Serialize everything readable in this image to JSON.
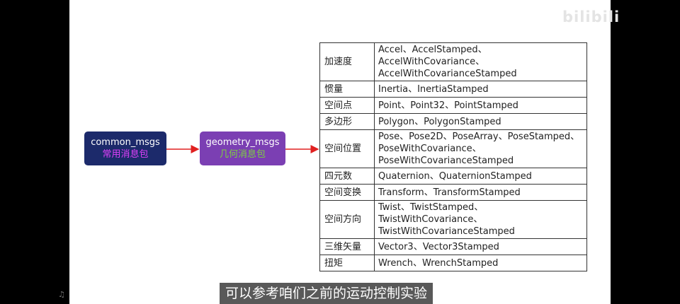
{
  "watermark": "bilibili",
  "nodes": {
    "common": {
      "title": "common_msgs",
      "subtitle": "常用消息包"
    },
    "geometry": {
      "title": "geometry_msgs",
      "subtitle": "几何消息包"
    }
  },
  "rows": [
    {
      "category": "加速度",
      "types": "Accel、AccelStamped、AccelWithCovariance、AccelWithCovarianceStamped"
    },
    {
      "category": "惯量",
      "types": "Inertia、InertiaStamped"
    },
    {
      "category": "空间点",
      "types": "Point、Point32、PointStamped"
    },
    {
      "category": "多边形",
      "types": "Polygon、PolygonStamped"
    },
    {
      "category": "空间位置",
      "types": "Pose、Pose2D、PoseArray、PoseStamped、PoseWithCovariance、PoseWithCovarianceStamped"
    },
    {
      "category": "四元数",
      "types": "Quaternion、QuaternionStamped"
    },
    {
      "category": "空间变换",
      "types": "Transform、TransformStamped"
    },
    {
      "category": "空间方向",
      "types": "Twist、TwistStamped、TwistWithCovariance、TwistWithCovarianceStamped"
    },
    {
      "category": "三维矢量",
      "types": "Vector3、Vector3Stamped"
    },
    {
      "category": "扭矩",
      "types": "Wrench、WrenchStamped"
    }
  ],
  "subtitle": "可以参考咱们之前的运动控制实验",
  "colors": {
    "common_bg": "#1c2a6b",
    "geometry_bg": "#7b3fb3",
    "arrow": "#e02020"
  }
}
